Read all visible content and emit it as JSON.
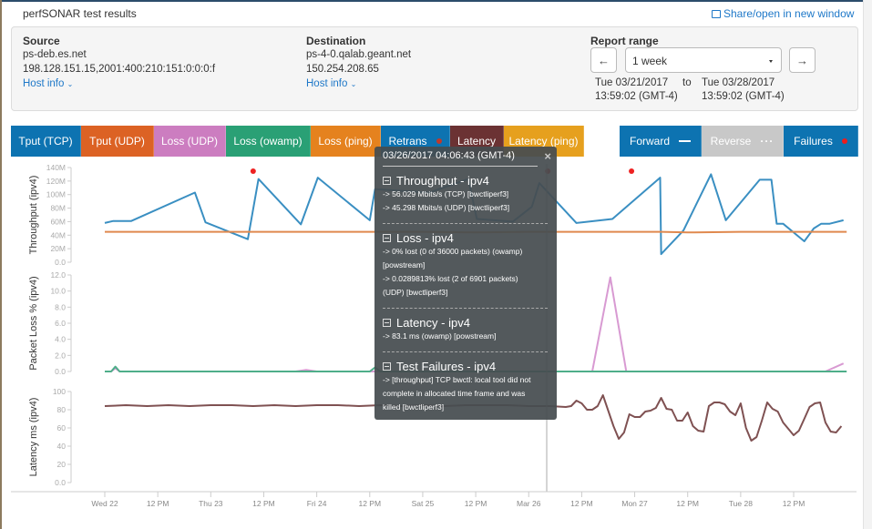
{
  "page": {
    "title": "perfSONAR test results",
    "share_link": "Share/open in new window"
  },
  "source": {
    "label": "Source",
    "host": "ps-deb.es.net",
    "addresses": "198.128.151.15,2001:400:210:151:0:0:0:f",
    "host_info": "Host info"
  },
  "destination": {
    "label": "Destination",
    "host": "ps-4-0.qalab.geant.net",
    "addresses": "150.254.208.65",
    "host_info": "Host info"
  },
  "report_range": {
    "label": "Report range",
    "selected": "1 week",
    "start_date": "Tue 03/21/2017",
    "start_time": "13:59:02 (GMT-4)",
    "to": "to",
    "end_date": "Tue 03/28/2017",
    "end_time": "13:59:02 (GMT-4)"
  },
  "legend_tabs": [
    {
      "label": "Tput (TCP)",
      "color": "#0d73b1"
    },
    {
      "label": "Tput (UDP)",
      "color": "#dc6224"
    },
    {
      "label": "Loss (UDP)",
      "color": "#cc7dc0"
    },
    {
      "label": "Loss (owamp)",
      "color": "#2aa075"
    },
    {
      "label": "Loss (ping)",
      "color": "#e5821e"
    },
    {
      "label": "Retrans",
      "color": "#0d73b1"
    },
    {
      "label": "Latency",
      "color": "#6b3233"
    },
    {
      "label": "Latency (ping)",
      "color": "#e6a01e"
    }
  ],
  "direction_tabs": [
    {
      "label": "Forward",
      "color": "#0d73b1",
      "marker": "line"
    },
    {
      "label": "Reverse",
      "color": "#c8c8c8",
      "marker": "dots"
    },
    {
      "label": "Failures",
      "color": "#0d73b1",
      "marker": "dot"
    }
  ],
  "tooltip": {
    "timestamp": "03/26/2017 04:06:43 (GMT-4)",
    "close": "×",
    "sections": [
      {
        "title": "Throughput - ipv4",
        "lines": [
          "-> 56.029 Mbits/s (TCP) [bwctliperf3]",
          "-> 45.298 Mbits/s (UDP) [bwctliperf3]"
        ]
      },
      {
        "title": "Loss - ipv4",
        "lines": [
          "-> 0% lost (0 of 36000 packets) (owamp)",
          "[powstream]",
          "-> 0.0289813% lost (2 of 6901 packets)",
          "(UDP) [bwctliperf3]"
        ]
      },
      {
        "title": "Latency - ipv4",
        "lines": [
          "-> 83.1 ms (owamp) [powstream]"
        ]
      },
      {
        "title": "Test Failures - ipv4",
        "lines": [
          "-> [throughput] TCP bwctl: local tool did not",
          "complete in allocated time frame and was",
          "killed [bwctliperf3]"
        ]
      }
    ]
  },
  "chart_data": [
    {
      "type": "line",
      "title": "Throughput (ipv4)",
      "ylabel": "Throughput (ipv4)",
      "ylim": [
        0,
        140
      ],
      "y_unit": "Mbit/s",
      "yticks": [
        "0.0",
        "20M",
        "40M",
        "60M",
        "80M",
        "100M",
        "120M",
        "140M"
      ],
      "xlim": [
        0,
        7.05
      ],
      "x_unit": "days since Wed 22 00:00",
      "series": [
        {
          "name": "Tput (TCP)",
          "color": "#3a8fc2",
          "x": [
            0.0,
            0.08,
            0.25,
            0.85,
            0.95,
            1.35,
            1.45,
            1.85,
            2.01,
            2.5,
            2.55,
            3.06,
            3.43,
            3.51,
            3.85,
            4.03,
            4.1,
            4.45,
            4.79,
            5.24,
            5.25,
            5.46,
            5.72,
            5.86,
            6.18,
            6.29,
            6.34,
            6.4,
            6.6,
            6.69,
            6.76,
            6.84,
            6.97
          ],
          "y": [
            58,
            61,
            61,
            103,
            59,
            34,
            123,
            56,
            125,
            62,
            108,
            103,
            123,
            64,
            60,
            82,
            117,
            58,
            64,
            125,
            12,
            47,
            130,
            62,
            122,
            122,
            57,
            57,
            31,
            50,
            57,
            57,
            62
          ]
        },
        {
          "name": "Tput (UDP)",
          "color": "#e0894e",
          "x": [
            0,
            1,
            2,
            2.5,
            3,
            3.5,
            4,
            4.5,
            5,
            5.25,
            5.5,
            6,
            6.5,
            7.0
          ],
          "y": [
            45,
            45,
            45,
            45,
            45,
            44,
            45,
            45,
            45,
            45,
            44,
            45,
            45,
            45
          ]
        }
      ],
      "failures_x": [
        1.4,
        4.18,
        4.97
      ]
    },
    {
      "type": "line",
      "title": "Packet Loss % (ipv4)",
      "ylabel": "Packet Loss % (ipv4)",
      "ylim": [
        0,
        12
      ],
      "yticks": [
        "0.0",
        "2.0",
        "4.0",
        "6.0",
        "8.0",
        "10.0",
        "12.0"
      ],
      "series": [
        {
          "name": "Loss (UDP)",
          "color": "#d89ad2",
          "x": [
            0,
            0.06,
            0.1,
            0.14,
            1.8,
            1.9,
            2.0,
            4.6,
            4.77,
            4.92,
            6.8,
            6.97
          ],
          "y": [
            0,
            0,
            0.4,
            0,
            0,
            0.2,
            0,
            0,
            11.7,
            0,
            0,
            1.0
          ]
        },
        {
          "name": "Loss (owamp)",
          "color": "#4fae8a",
          "x": [
            0,
            0.06,
            0.1,
            0.14,
            2.5,
            2.55,
            2.6,
            4.0,
            7.0
          ],
          "y": [
            0,
            0,
            0.6,
            0,
            0,
            0.5,
            0,
            0,
            0
          ]
        }
      ]
    },
    {
      "type": "line",
      "title": "Latency ms (ipv4)",
      "ylabel": "Latency ms (ipv4)",
      "ylim": [
        0,
        100
      ],
      "yticks": [
        "0.0",
        "20",
        "40",
        "60",
        "80",
        "100"
      ],
      "series": [
        {
          "name": "Latency",
          "color": "#7f5152",
          "x": [
            0,
            0.2,
            0.4,
            0.6,
            0.8,
            1.0,
            1.2,
            1.4,
            1.6,
            1.8,
            2.0,
            2.2,
            2.4,
            2.6,
            2.8,
            3.0,
            3.2,
            3.4,
            3.6,
            3.8,
            4.0,
            4.2,
            4.35,
            4.4,
            4.45,
            4.5,
            4.55,
            4.6,
            4.65,
            4.7,
            4.75,
            4.8,
            4.85,
            4.9,
            4.95,
            5.0,
            5.05,
            5.1,
            5.15,
            5.2,
            5.25,
            5.3,
            5.35,
            5.4,
            5.45,
            5.5,
            5.55,
            5.6,
            5.65,
            5.7,
            5.75,
            5.8,
            5.85,
            5.9,
            5.95,
            6.0,
            6.05,
            6.1,
            6.15,
            6.2,
            6.25,
            6.3,
            6.35,
            6.4,
            6.45,
            6.5,
            6.55,
            6.6,
            6.65,
            6.7,
            6.75,
            6.8,
            6.85,
            6.9,
            6.95
          ],
          "y": [
            84,
            85,
            84,
            85,
            84,
            85,
            85,
            84,
            85,
            84,
            85,
            85,
            84,
            85,
            84,
            85,
            84,
            85,
            85,
            85,
            84,
            84,
            83,
            84,
            90,
            87,
            80,
            80,
            84,
            96,
            79,
            62,
            48,
            55,
            75,
            72,
            72,
            78,
            79,
            82,
            93,
            81,
            80,
            68,
            68,
            77,
            62,
            57,
            56,
            84,
            88,
            88,
            86,
            78,
            74,
            87,
            60,
            46,
            50,
            68,
            88,
            81,
            78,
            66,
            59,
            52,
            57,
            70,
            83,
            87,
            88,
            66,
            56,
            55,
            62
          ],
          "_note_x": "approximate sample times"
        }
      ]
    }
  ],
  "x_axis": {
    "ticks": [
      "Wed 22",
      "12 PM",
      "Thu 23",
      "12 PM",
      "Fri 24",
      "12 PM",
      "Sat 25",
      "12 PM",
      "Mar 26",
      "12 PM",
      "Mon 27",
      "12 PM",
      "Tue 28",
      "12 PM"
    ]
  },
  "cursor_x": 4.17
}
